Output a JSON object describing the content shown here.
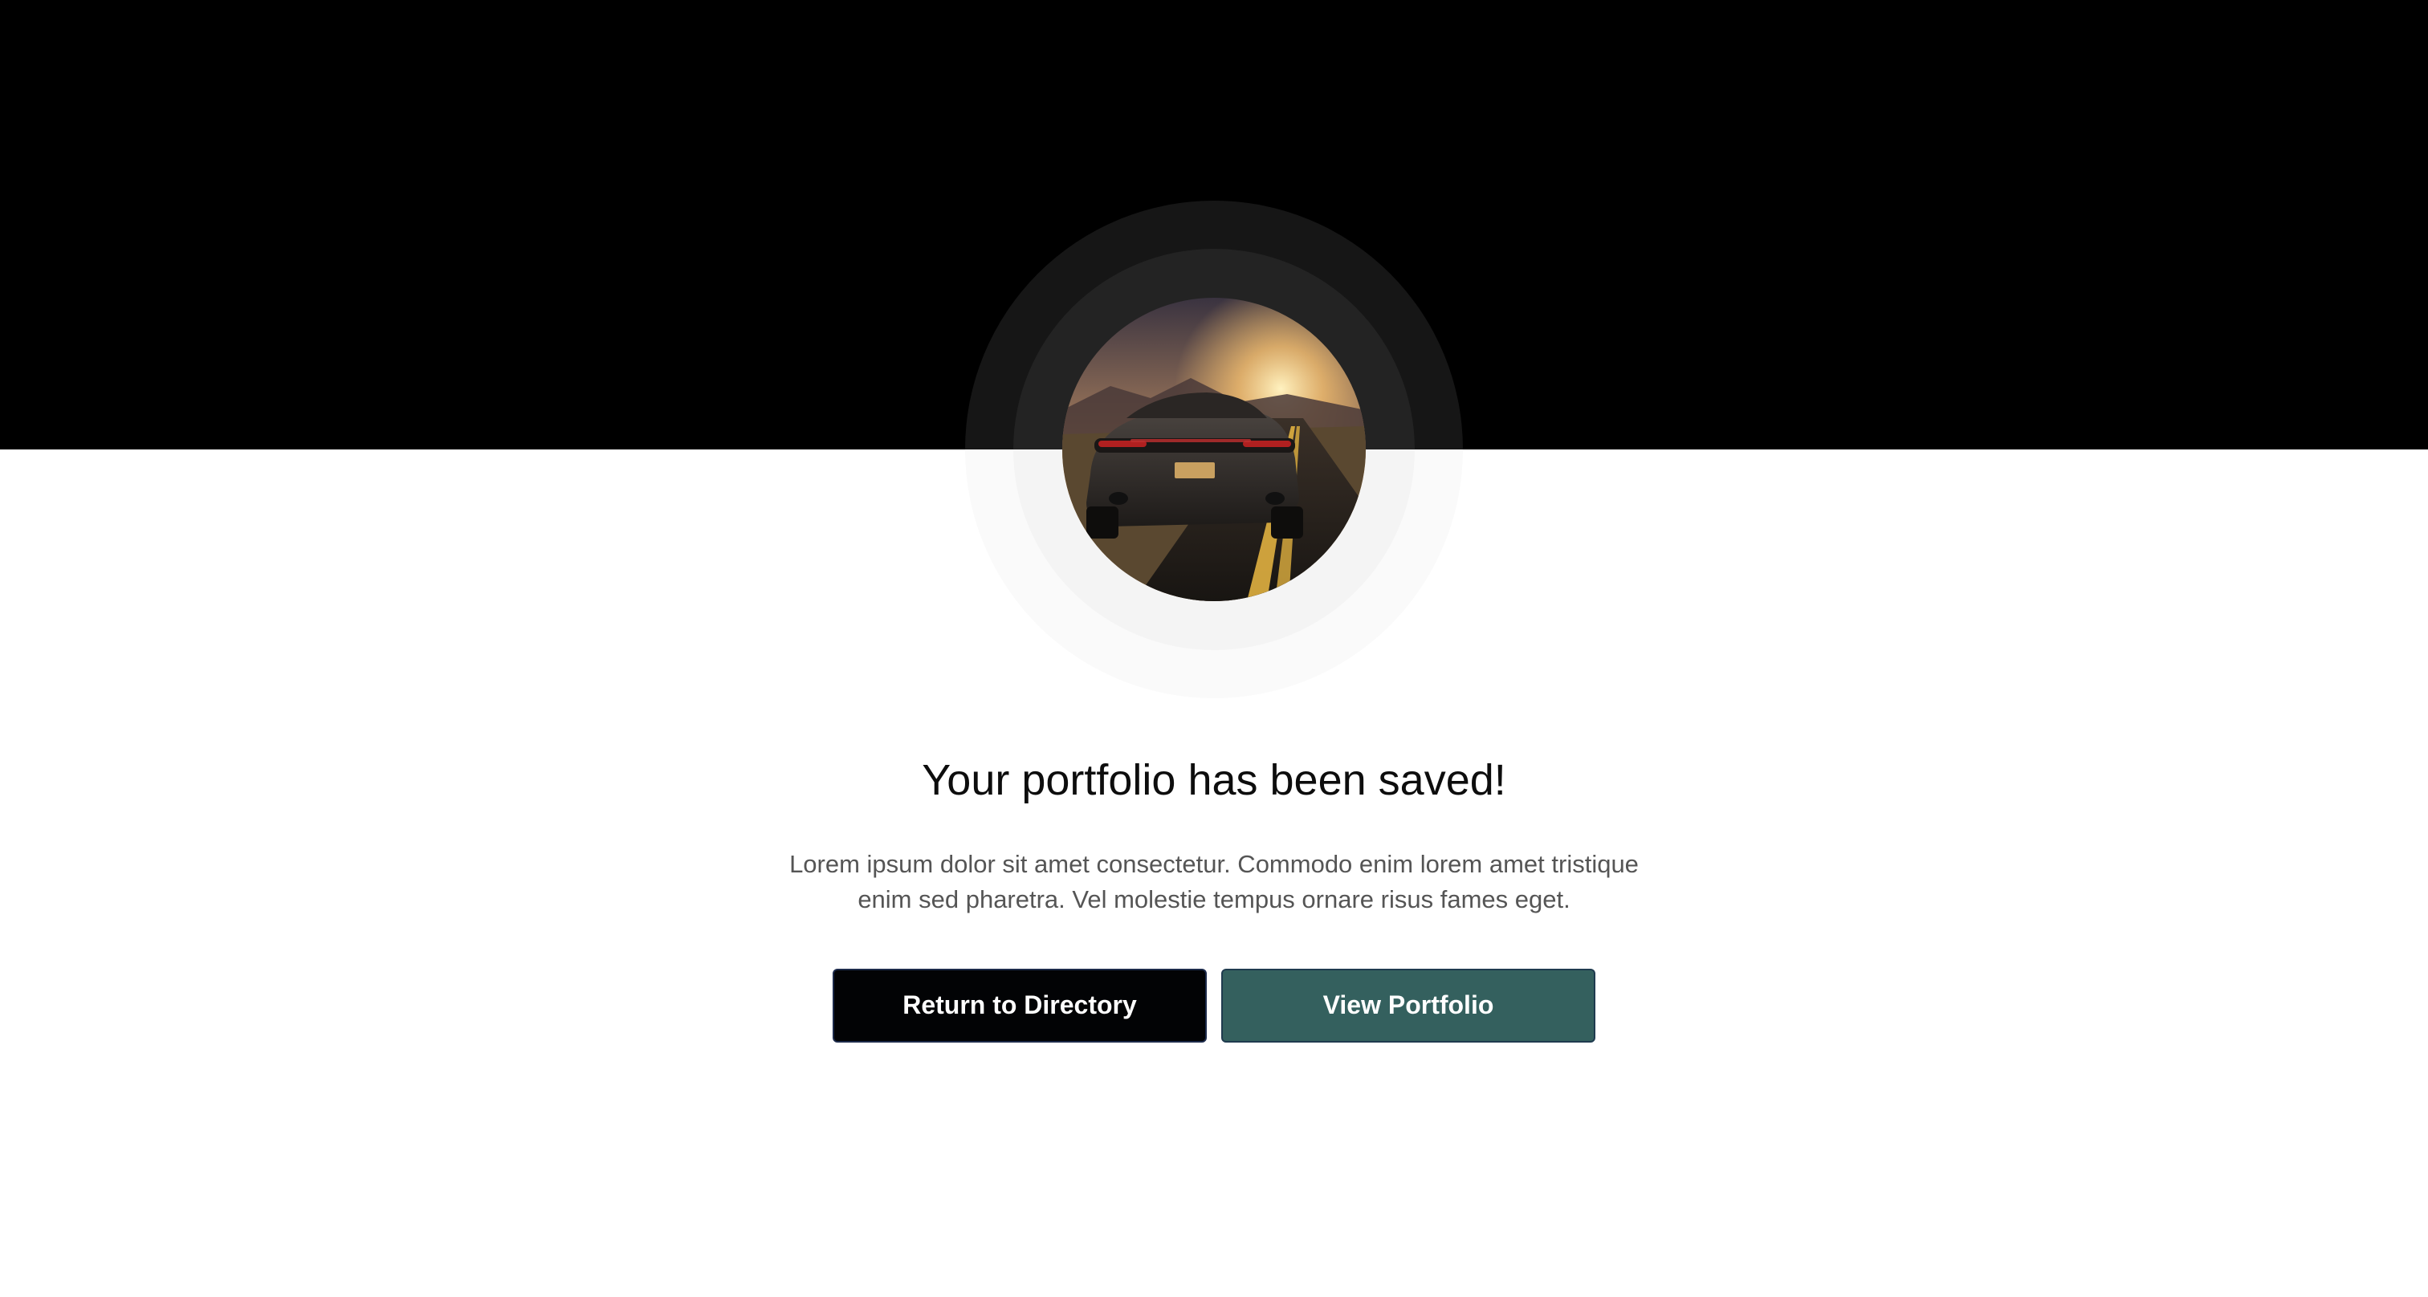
{
  "colors": {
    "hero_band": "#000000",
    "background": "#ffffff",
    "primary_button": "#020305",
    "secondary_button": "#34605e",
    "title_text": "#0d0d0d",
    "body_text": "#555555"
  },
  "hero": {
    "avatar_image": "sports-car-sunset-road-photo"
  },
  "main": {
    "title": "Your portfolio has been saved!",
    "description": "Lorem ipsum dolor sit amet consectetur. Commodo enim lorem amet tristique enim sed pharetra. Vel molestie tempus ornare risus fames eget."
  },
  "actions": {
    "return_label": "Return to Directory",
    "view_label": "View Portfolio"
  }
}
